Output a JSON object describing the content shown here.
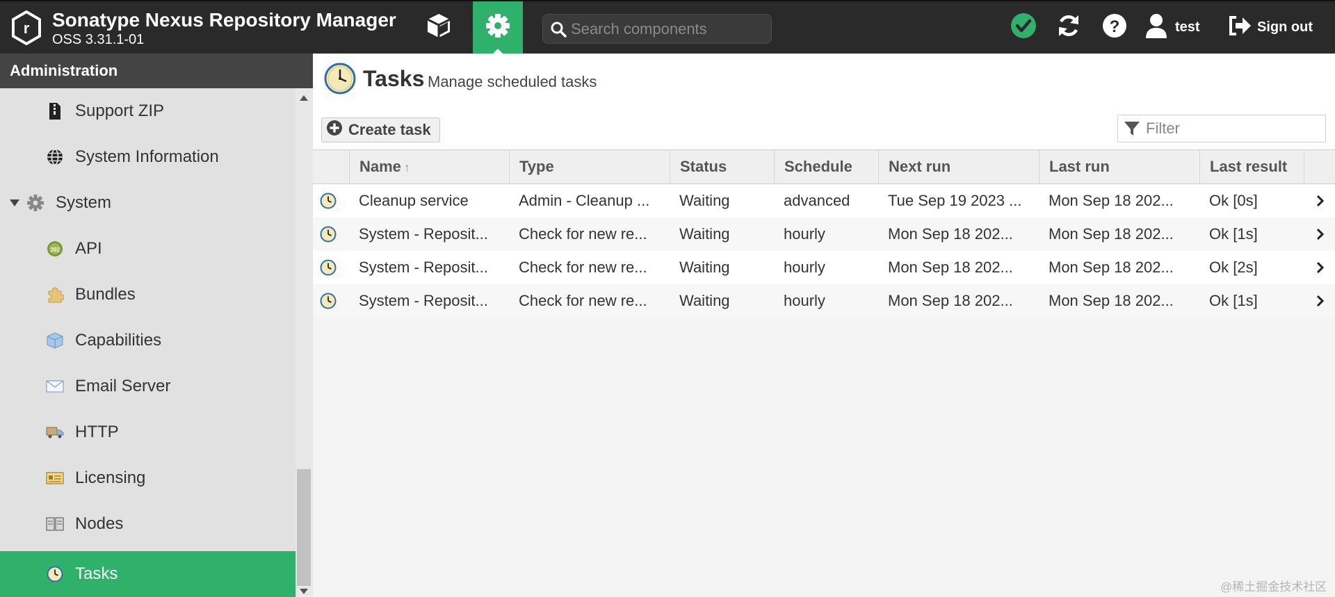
{
  "header": {
    "title": "Sonatype Nexus Repository Manager",
    "version": "OSS 3.31.1-01",
    "search_placeholder": "Search components",
    "user_name": "test",
    "signout_label": "Sign out",
    "accent_color": "#2fb06b",
    "icons": [
      "nexus-logo-icon",
      "cube-icon",
      "gear-icon",
      "search-icon",
      "check-circle-icon",
      "refresh-icon",
      "help-icon",
      "user-icon",
      "sign-out-icon"
    ]
  },
  "sidebar": {
    "title": "Administration",
    "items": [
      {
        "label": "Support ZIP",
        "icon": "zip-file-icon"
      },
      {
        "label": "System Information",
        "icon": "globe-icon"
      },
      {
        "label": "System",
        "icon": "gear-icon",
        "expanded": true
      },
      {
        "label": "API",
        "icon": "api-icon"
      },
      {
        "label": "Bundles",
        "icon": "puzzle-icon"
      },
      {
        "label": "Capabilities",
        "icon": "box-icon"
      },
      {
        "label": "Email Server",
        "icon": "envelope-icon"
      },
      {
        "label": "HTTP",
        "icon": "truck-icon"
      },
      {
        "label": "Licensing",
        "icon": "license-icon"
      },
      {
        "label": "Nodes",
        "icon": "nodes-icon"
      },
      {
        "label": "Tasks",
        "icon": "clock-icon",
        "active": true
      }
    ]
  },
  "main": {
    "title": "Tasks",
    "subtitle": "Manage scheduled tasks",
    "create_label": "Create task",
    "filter_placeholder": "Filter",
    "columns": [
      "Name",
      "Type",
      "Status",
      "Schedule",
      "Next run",
      "Last run",
      "Last result"
    ],
    "sort_indicator": "↑",
    "rows": [
      {
        "name": "Cleanup service",
        "type": "Admin - Cleanup ...",
        "status": "Waiting",
        "schedule": "advanced",
        "next_run": "Tue Sep 19 2023 ...",
        "last_run": "Mon Sep 18 202...",
        "last_result": "Ok [0s]"
      },
      {
        "name": "System - Reposit...",
        "type": "Check for new re...",
        "status": "Waiting",
        "schedule": "hourly",
        "next_run": "Mon Sep 18 202...",
        "last_run": "Mon Sep 18 202...",
        "last_result": "Ok [1s]"
      },
      {
        "name": "System - Reposit...",
        "type": "Check for new re...",
        "status": "Waiting",
        "schedule": "hourly",
        "next_run": "Mon Sep 18 202...",
        "last_run": "Mon Sep 18 202...",
        "last_result": "Ok [2s]"
      },
      {
        "name": "System - Reposit...",
        "type": "Check for new re...",
        "status": "Waiting",
        "schedule": "hourly",
        "next_run": "Mon Sep 18 202...",
        "last_run": "Mon Sep 18 202...",
        "last_result": "Ok [1s]"
      }
    ]
  },
  "watermark": "@稀土掘金技术社区"
}
